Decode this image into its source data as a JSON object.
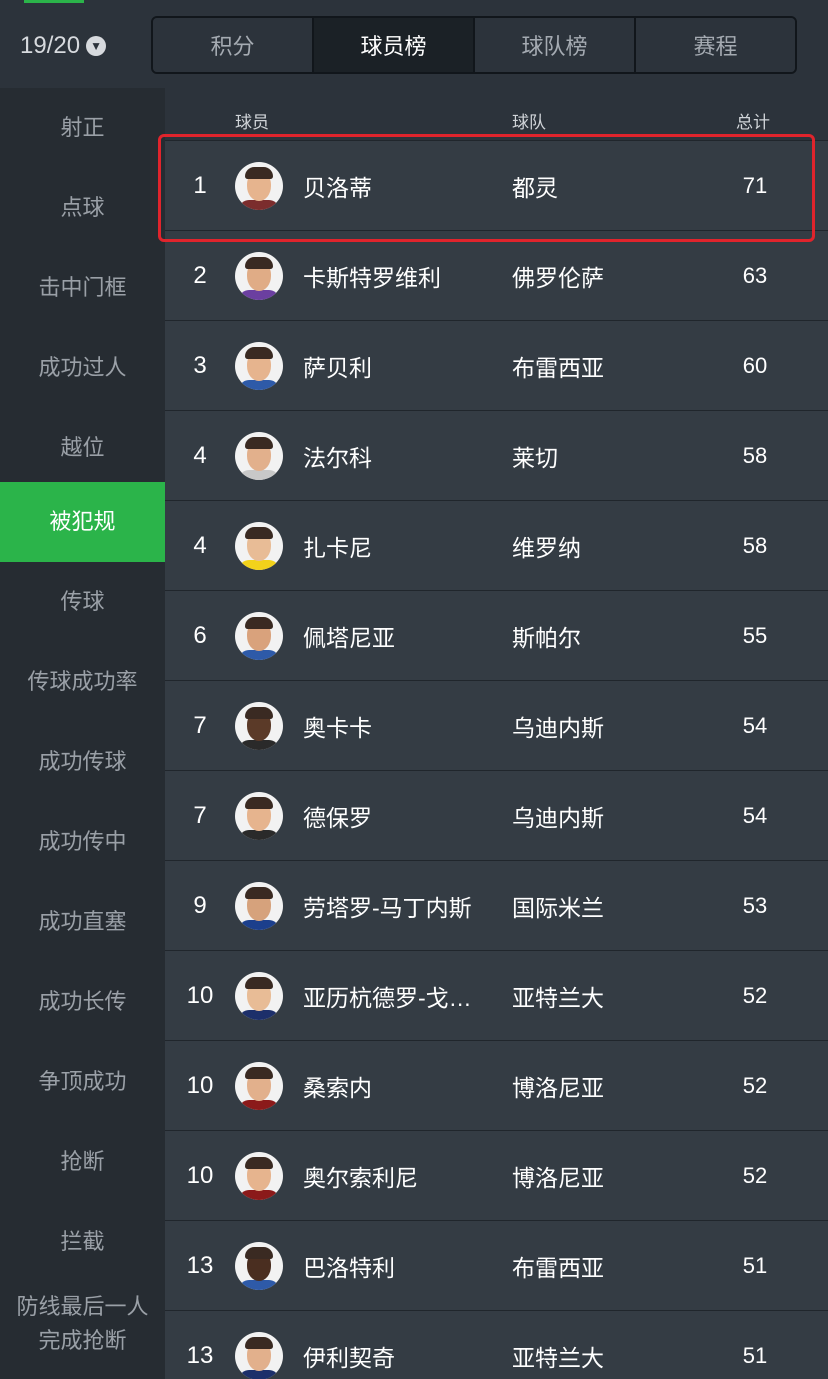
{
  "header": {
    "season": "19/20",
    "season_icon": "chevron-down-icon",
    "tabs": [
      {
        "label": "积分"
      },
      {
        "label": "球员榜"
      },
      {
        "label": "球队榜"
      },
      {
        "label": "赛程"
      }
    ],
    "active_tab": 1
  },
  "sidebar": {
    "items": [
      {
        "label": "射正"
      },
      {
        "label": "点球"
      },
      {
        "label": "击中门框"
      },
      {
        "label": "成功过人"
      },
      {
        "label": "越位"
      },
      {
        "label": "被犯规"
      },
      {
        "label": "传球"
      },
      {
        "label": "传球成功率"
      },
      {
        "label": "成功传球"
      },
      {
        "label": "成功传中"
      },
      {
        "label": "成功直塞"
      },
      {
        "label": "成功长传"
      },
      {
        "label": "争顶成功"
      },
      {
        "label": "抢断"
      },
      {
        "label": "拦截"
      },
      {
        "label_line1": "防线最后一人",
        "label_line2": "完成抢断"
      }
    ],
    "active_index": 5
  },
  "table": {
    "columns": {
      "player": "球员",
      "team": "球队",
      "total": "总计"
    },
    "rows": [
      {
        "rank": "1",
        "name": "贝洛蒂",
        "team": "都灵",
        "total": "71"
      },
      {
        "rank": "2",
        "name": "卡斯特罗维利",
        "team": "佛罗伦萨",
        "total": "63"
      },
      {
        "rank": "3",
        "name": "萨贝利",
        "team": "布雷西亚",
        "total": "60"
      },
      {
        "rank": "4",
        "name": "法尔科",
        "team": "莱切",
        "total": "58"
      },
      {
        "rank": "4",
        "name": "扎卡尼",
        "team": "维罗纳",
        "total": "58"
      },
      {
        "rank": "6",
        "name": "佩塔尼亚",
        "team": "斯帕尔",
        "total": "55"
      },
      {
        "rank": "7",
        "name": "奥卡卡",
        "team": "乌迪内斯",
        "total": "54"
      },
      {
        "rank": "7",
        "name": "德保罗",
        "team": "乌迪内斯",
        "total": "54"
      },
      {
        "rank": "9",
        "name": "劳塔罗-马丁内斯",
        "team": "国际米兰",
        "total": "53"
      },
      {
        "rank": "10",
        "name": "亚历杭德罗-戈…",
        "team": "亚特兰大",
        "total": "52"
      },
      {
        "rank": "10",
        "name": "桑索内",
        "team": "博洛尼亚",
        "total": "52"
      },
      {
        "rank": "10",
        "name": "奥尔索利尼",
        "team": "博洛尼亚",
        "total": "52"
      },
      {
        "rank": "13",
        "name": "巴洛特利",
        "team": "布雷西亚",
        "total": "51"
      },
      {
        "rank": "13",
        "name": "伊利契奇",
        "team": "亚特兰大",
        "total": "51"
      }
    ],
    "highlighted_row": 0
  },
  "colors": {
    "accent": "#2bb44a",
    "highlight_border": "#e0242c",
    "background": "#2c333b",
    "sidebar": "#262c32"
  }
}
